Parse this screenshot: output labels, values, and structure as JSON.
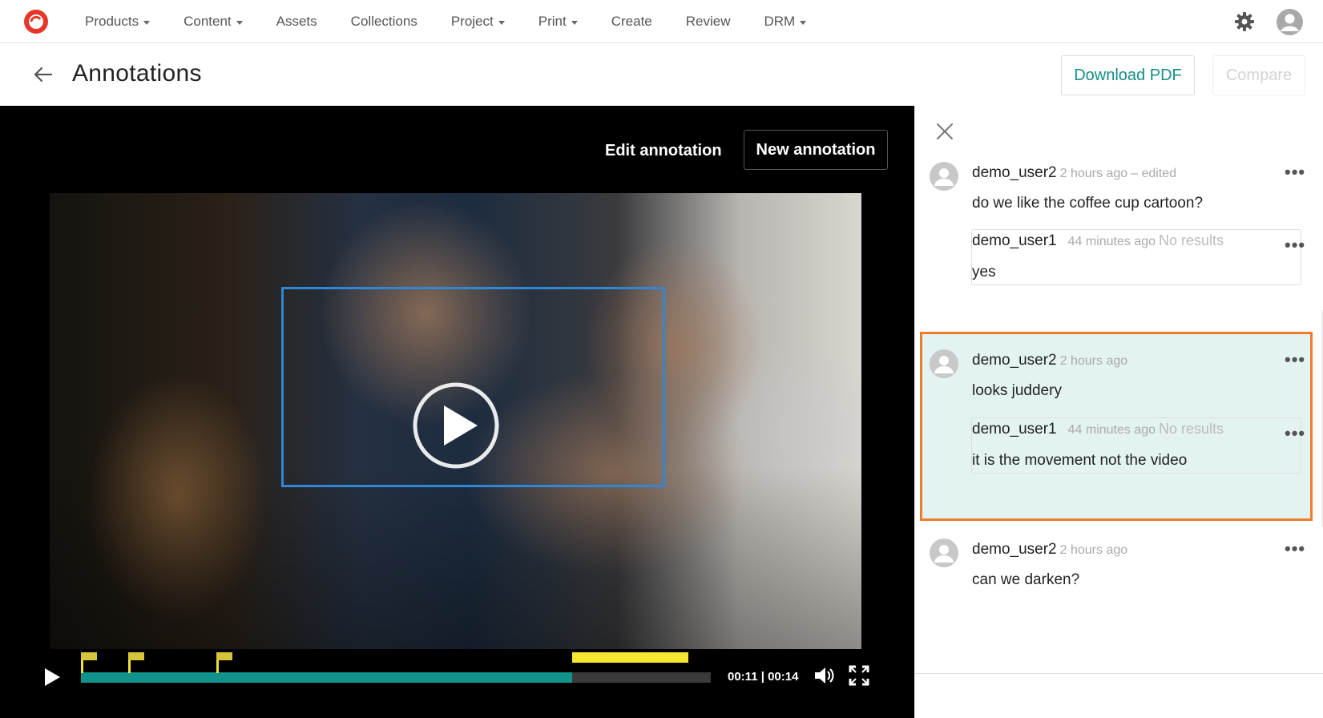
{
  "nav": {
    "items": [
      {
        "label": "Products",
        "dropdown": true
      },
      {
        "label": "Content",
        "dropdown": true
      },
      {
        "label": "Assets",
        "dropdown": false
      },
      {
        "label": "Collections",
        "dropdown": false
      },
      {
        "label": "Project",
        "dropdown": true
      },
      {
        "label": "Print",
        "dropdown": true
      },
      {
        "label": "Create",
        "dropdown": false
      },
      {
        "label": "Review",
        "dropdown": false
      },
      {
        "label": "DRM",
        "dropdown": true
      }
    ]
  },
  "header": {
    "title": "Annotations",
    "download_pdf": "Download PDF",
    "compare": "Compare"
  },
  "video": {
    "edit_annotation": "Edit annotation",
    "new_annotation": "New annotation",
    "time": "00:11 | 00:14",
    "progress": 0.78,
    "markers": [
      0.0,
      0.075,
      0.215
    ],
    "range": [
      0.78,
      0.965
    ]
  },
  "comments": {
    "threads": [
      {
        "user": "demo_user2",
        "time": "2 hours ago",
        "edited": "– edited",
        "text": "do we like the coffee cup cartoon?",
        "reply": {
          "user": "demo_user1",
          "time": "44 minutes ago",
          "status": "No results",
          "text": "yes"
        }
      },
      {
        "user": "demo_user2",
        "time": "2 hours ago",
        "text": "looks juddery",
        "active": true,
        "reply": {
          "user": "demo_user1",
          "time": "44 minutes ago",
          "status": "No results",
          "text": "it is the movement not the video"
        }
      },
      {
        "user": "demo_user2",
        "time": "2 hours ago",
        "text": "can we darken?"
      }
    ],
    "more_label": "•••"
  },
  "colors": {
    "accent": "#128f87",
    "active_border": "#f07b2a",
    "active_bg": "#e3f3f1",
    "annotation_box": "#2f87d8",
    "marker": "#f6e532"
  }
}
